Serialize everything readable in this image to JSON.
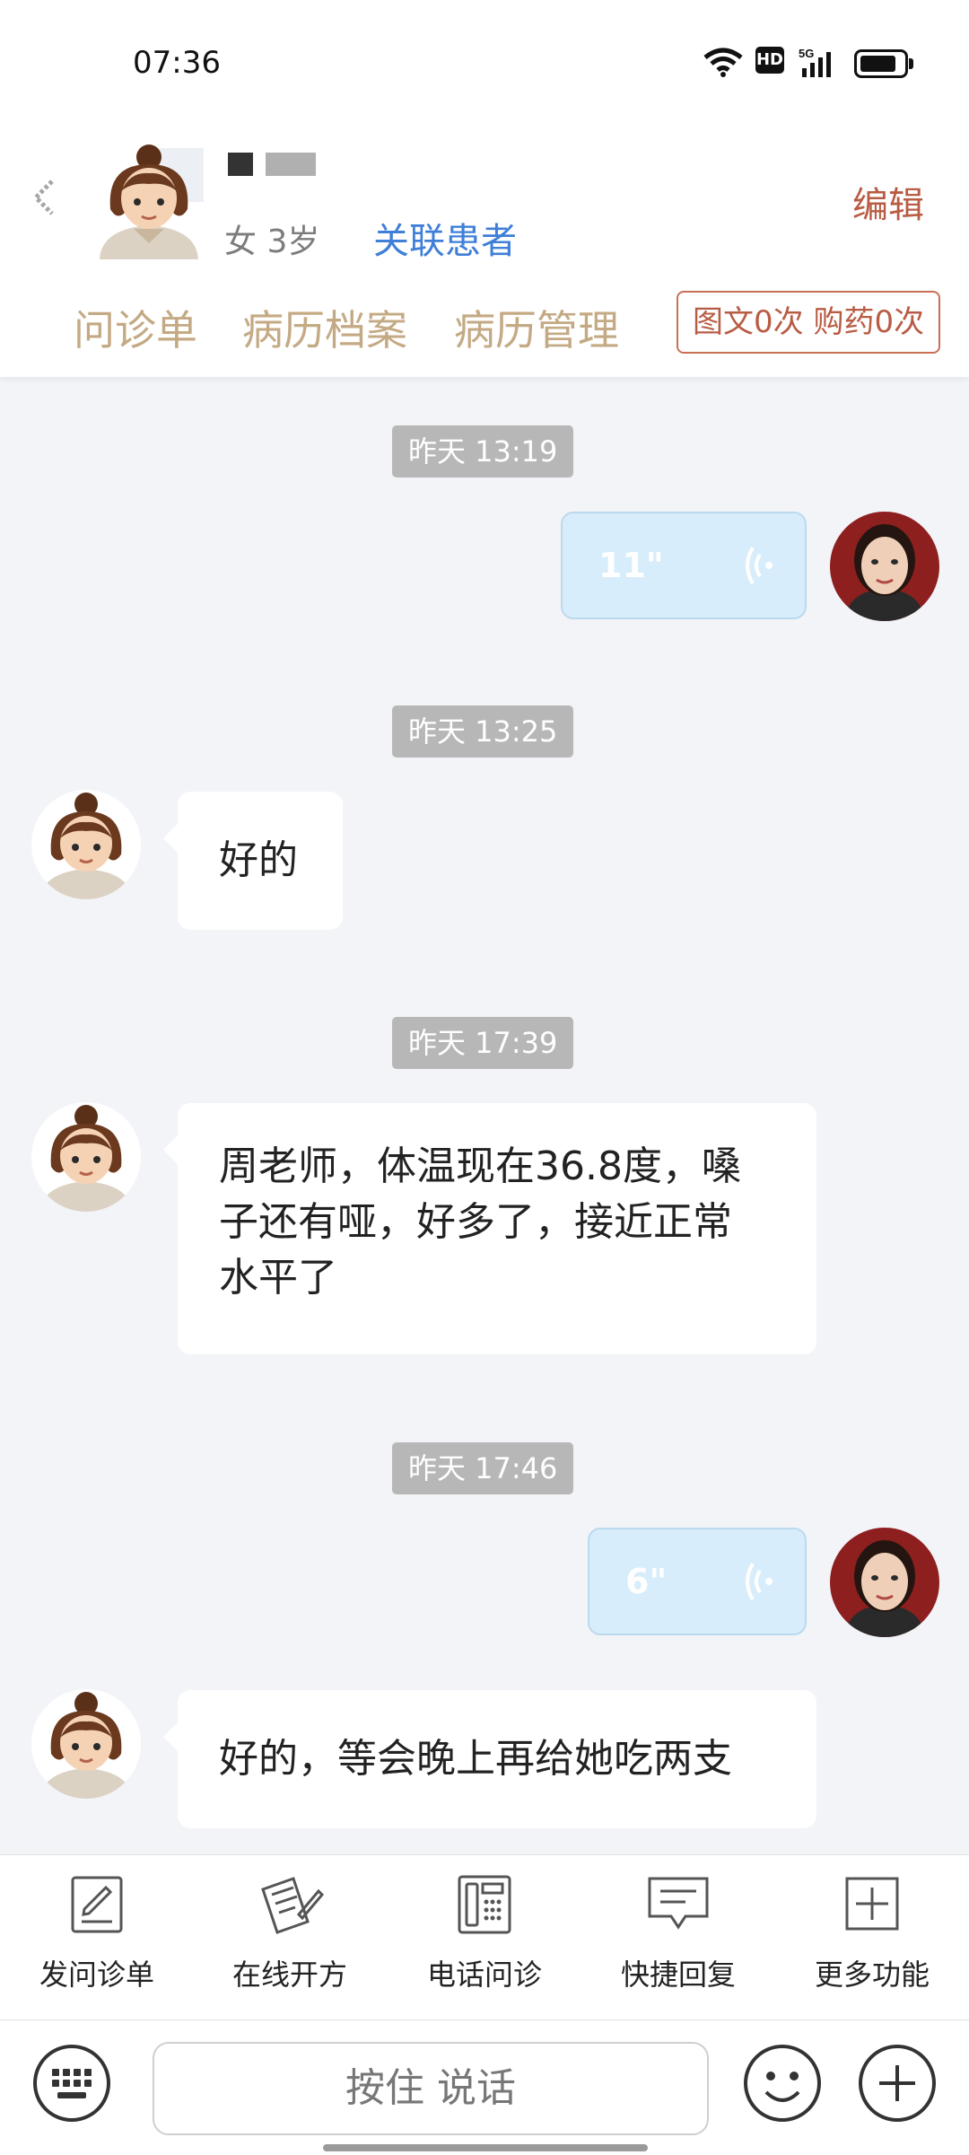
{
  "status_bar": {
    "time": "07:36",
    "hd": "HD",
    "network": "5G",
    "battery_level": 0.85
  },
  "header": {
    "patient_info": "女 3岁",
    "link_patient": "关联患者",
    "edit": "编辑"
  },
  "tabs": [
    {
      "label": "问诊单"
    },
    {
      "label": "病历档案"
    },
    {
      "label": "病历管理"
    }
  ],
  "counts_badge": "图文0次 购药0次",
  "messages": [
    {
      "type": "timestamp",
      "text": "昨天 13:19"
    },
    {
      "type": "voice",
      "side": "right",
      "duration": "11\""
    },
    {
      "type": "timestamp",
      "text": "昨天 13:25"
    },
    {
      "type": "text",
      "side": "left",
      "text": "好的"
    },
    {
      "type": "timestamp",
      "text": "昨天 17:39"
    },
    {
      "type": "text",
      "side": "left",
      "lines": [
        "周老师，体温现在36.8度，嗓",
        "子还有哑，好多了，接近正常",
        "水平了"
      ]
    },
    {
      "type": "timestamp",
      "text": "昨天 17:46"
    },
    {
      "type": "voice",
      "side": "right",
      "duration": "6\""
    },
    {
      "type": "text",
      "side": "left",
      "text": "好的，等会晚上再给她吃两支"
    }
  ],
  "toolbar": [
    {
      "label": "发问诊单",
      "icon": "form-edit-icon"
    },
    {
      "label": "在线开方",
      "icon": "prescription-icon"
    },
    {
      "label": "电话问诊",
      "icon": "phone-icon"
    },
    {
      "label": "快捷回复",
      "icon": "chat-bubble-icon"
    },
    {
      "label": "更多功能",
      "icon": "plus-square-icon"
    }
  ],
  "input_bar": {
    "hold_to_talk": "按住 说话",
    "left_icon": "keyboard-icon",
    "emoji_icon": "emoji-icon",
    "add_icon": "plus-circle-icon"
  }
}
